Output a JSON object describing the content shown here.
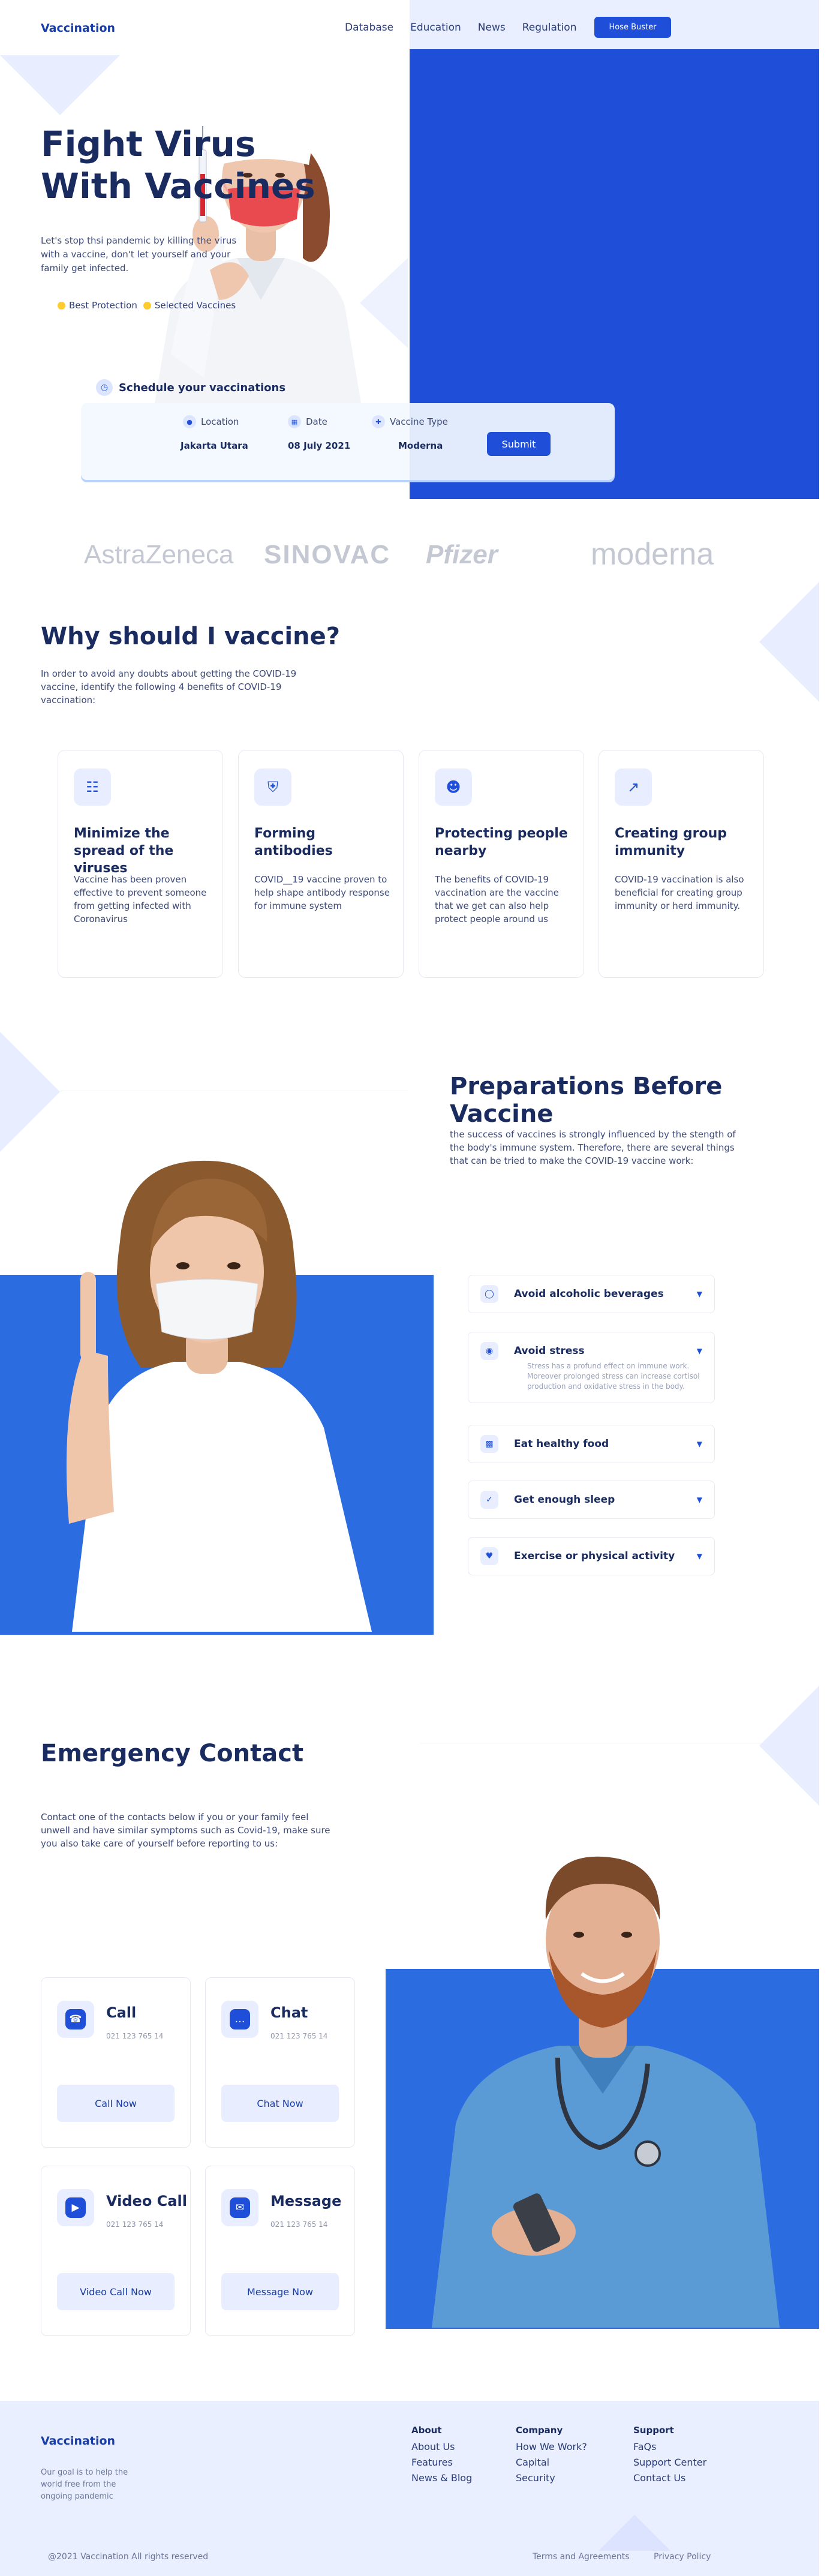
{
  "brand": "Vaccination",
  "nav": {
    "items": [
      "Database",
      "Education",
      "News",
      "Regulation"
    ],
    "cta": "Hose Buster"
  },
  "hero": {
    "title_line1": "Fight Virus",
    "title_line2": "With Vaccines",
    "description": "Let's stop thsi pandemic by killing the virus with a vaccine, don't let yourself and your family get infected.",
    "badges": [
      "Best Protection",
      "Selected Vaccines"
    ]
  },
  "schedule": {
    "title": "Schedule your vaccinations",
    "fields": [
      {
        "label": "Location",
        "value": "Jakarta Utara",
        "icon": "location-icon"
      },
      {
        "label": "Date",
        "value": "08 July 2021",
        "icon": "calendar-icon"
      },
      {
        "label": "Vaccine Type",
        "value": "Moderna",
        "icon": "vaccine-icon"
      }
    ],
    "submit": "Submit"
  },
  "partners": [
    "AstraZeneca",
    "SINOVAC",
    "Pfizer",
    "moderna"
  ],
  "why": {
    "title": "Why should I vaccine?",
    "description": "In order to avoid any doubts about getting the COVID-19 vaccine, identify the following 4 benefits of COVID-19 vaccination:",
    "benefits": [
      {
        "title": "Minimize the spread of the viruses",
        "text": "Vaccine has been proven effective to prevent someone from getting infected with Coronavirus",
        "icon": "list-icon"
      },
      {
        "title": "Forming antibodies",
        "text": "COVID__19 vaccine proven to help shape antibody response for immune system",
        "icon": "shield-icon"
      },
      {
        "title": "Protecting people nearby",
        "text": "The benefits of COVID-19 vaccination are the vaccine that we get can also help protect people around us",
        "icon": "people-icon"
      },
      {
        "title": "Creating group immunity",
        "text": "COVID-19 vaccination is also beneficial for creating group immunity or herd immunity.",
        "icon": "trend-icon"
      }
    ]
  },
  "preparations": {
    "title": "Preparations Before Vaccine",
    "description": "the success of vaccines is strongly influenced by the stength of the body's immune system. Therefore, there are several things that can be tried to make the COVID-19 vaccine work:",
    "items": [
      {
        "label": "Avoid alcoholic beverages",
        "icon": "no-alcohol-icon",
        "body": ""
      },
      {
        "label": "Avoid stress",
        "icon": "stress-icon",
        "body": "Stress has a profund effect on immune work. Moreover prolonged stress can increase cortisol production and oxidative stress in the body."
      },
      {
        "label": "Eat healthy food",
        "icon": "food-icon",
        "body": ""
      },
      {
        "label": "Get enough sleep",
        "icon": "sleep-icon",
        "body": ""
      },
      {
        "label": "Exercise or physical activity",
        "icon": "heart-icon",
        "body": ""
      }
    ]
  },
  "emergency": {
    "title": "Emergency Contact",
    "description": "Contact one of the contacts below if you or your family feel unwell and have similar symptoms such as Covid-19, make sure you also take care of yourself before reporting to us:",
    "contacts": [
      {
        "name": "Call",
        "phone": "021 123 765 14",
        "button": "Call Now",
        "icon": "phone-icon"
      },
      {
        "name": "Chat",
        "phone": "021 123 765 14",
        "button": "Chat Now",
        "icon": "chat-icon"
      },
      {
        "name": "Video Call",
        "phone": "021 123 765 14",
        "button": "Video Call Now",
        "icon": "video-icon"
      },
      {
        "name": "Message",
        "phone": "021 123 765 14",
        "button": "Message Now",
        "icon": "mail-icon"
      }
    ]
  },
  "footer": {
    "brand": "Vaccination",
    "description": "Our goal is to help the world free from the ongoing pandemic",
    "columns": [
      {
        "title": "About",
        "links": [
          "About Us",
          "Features",
          "News & Blog"
        ]
      },
      {
        "title": "Company",
        "links": [
          "How We Work?",
          "Capital",
          "Security"
        ]
      },
      {
        "title": "Support",
        "links": [
          "FaQs",
          "Support Center",
          "Contact Us"
        ]
      }
    ],
    "copyright": "@2021 Vaccination All rights reserved",
    "legal": [
      "Terms and Agreements",
      "Privacy Policy"
    ]
  },
  "colors": {
    "primary": "#1f4fd8",
    "accent_blue": "#2b6de0",
    "navy": "#1a2b5f",
    "soft": "#e8eeff",
    "badge": "#ffcc2f",
    "mask": "#e84a4f"
  }
}
